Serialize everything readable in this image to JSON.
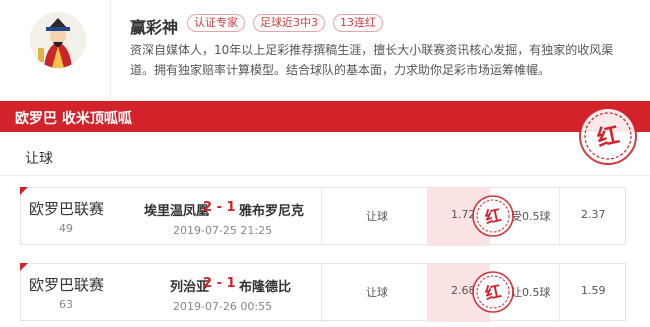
{
  "expert": {
    "name": "赢彩神",
    "tags": [
      "认证专家",
      "足球近3中3",
      "13连红"
    ],
    "description": "资深自媒体人，10年以上足彩推荐撰稿生涯，擅长大小联赛资讯核心发掘，有独家的收风渠道。拥有独家赔率计算模型。结合球队的基本面，力求助你足彩市场运筹帷幄。"
  },
  "section": {
    "title": "欧罗巴 收米顶呱呱",
    "subtitle": "让球",
    "stamp_text": "红"
  },
  "matches": [
    {
      "league": "欧罗巴联赛",
      "round": "49",
      "home": "埃里温凤凰",
      "score": "2 - 1",
      "away": "雅布罗尼克",
      "time": "2019-07-25 21:25",
      "market": "让球",
      "pick_odds": "1.72",
      "line": "受0.5球",
      "other_odds": "2.37",
      "stamp_text": "红"
    },
    {
      "league": "欧罗巴联赛",
      "round": "63",
      "home": "列治亚",
      "score": "2 - 1",
      "away": "布隆德比",
      "time": "2019-07-26 00:55",
      "market": "让球",
      "pick_odds": "2.68",
      "line": "让0.5球",
      "other_odds": "1.59",
      "stamp_text": "红"
    }
  ],
  "colors": {
    "brand_red": "#d2232a",
    "pick_bg": "#fbe3e3"
  }
}
